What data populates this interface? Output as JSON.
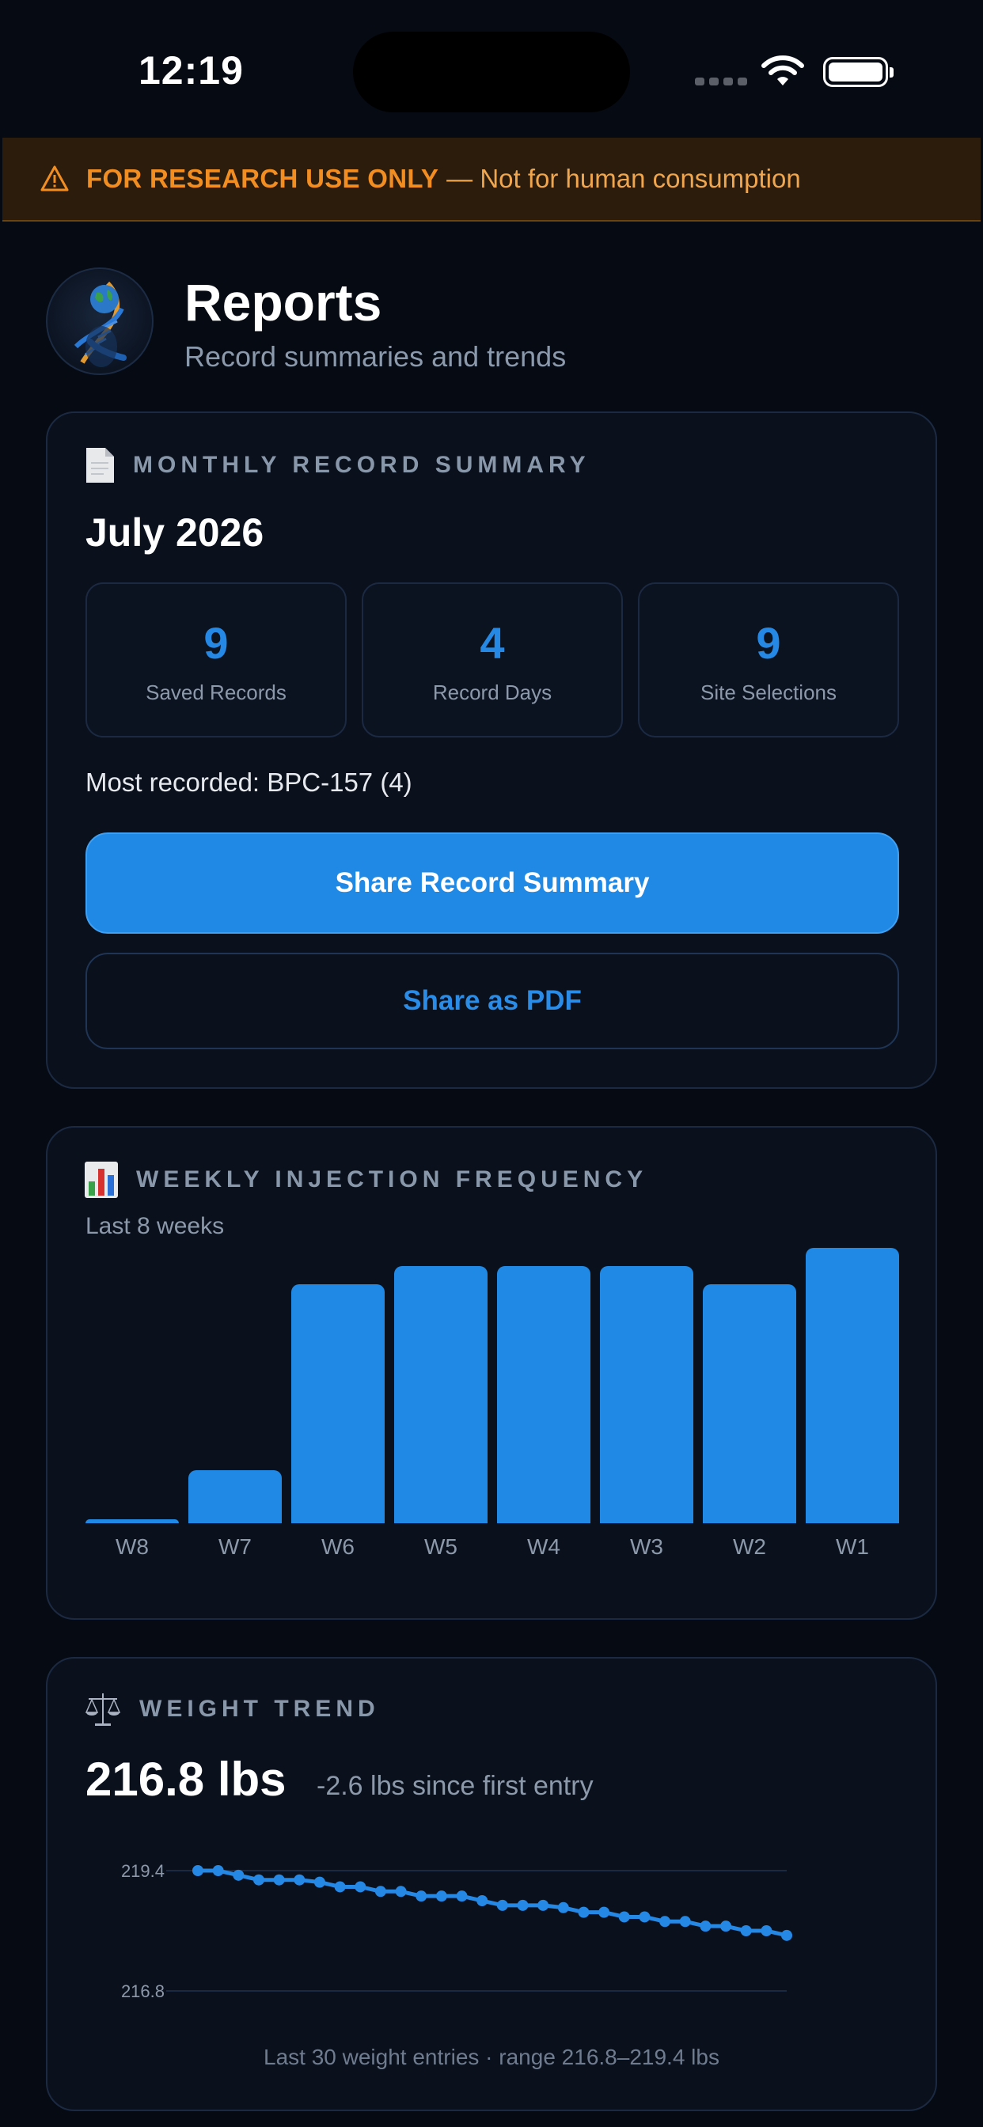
{
  "status": {
    "time": "12:19"
  },
  "warning": {
    "strong": "FOR RESEARCH USE ONLY",
    "rest": "— Not for human consumption"
  },
  "header": {
    "title": "Reports",
    "subtitle": "Record summaries and trends"
  },
  "summary": {
    "heading": "MONTHLY RECORD SUMMARY",
    "month": "July 2026",
    "stats": [
      {
        "value": "9",
        "label": "Saved Records"
      },
      {
        "value": "4",
        "label": "Record Days"
      },
      {
        "value": "9",
        "label": "Site Selections"
      }
    ],
    "most_recorded": "Most recorded: BPC-157 (4)",
    "share_button": "Share Record Summary",
    "pdf_button": "Share as PDF"
  },
  "frequency": {
    "heading": "WEEKLY INJECTION FREQUENCY",
    "subtitle": "Last 8 weeks"
  },
  "weight": {
    "heading": "WEIGHT TREND",
    "current": "216.8 lbs",
    "delta": "-2.6 lbs since first entry",
    "note": "Last 30 weight entries · range 216.8–219.4 lbs"
  },
  "chart_data": [
    {
      "type": "bar",
      "categories": [
        "W8",
        "W7",
        "W6",
        "W5",
        "W4",
        "W3",
        "W2",
        "W1"
      ],
      "values": [
        0.2,
        2.9,
        13,
        14,
        14,
        14,
        13,
        15
      ],
      "ylim": [
        0,
        15
      ],
      "color": "#1f89e5"
    },
    {
      "type": "line",
      "x": [
        1,
        2,
        3,
        4,
        5,
        6,
        7,
        8,
        9,
        10,
        11,
        12,
        13,
        14,
        15,
        16,
        17,
        18,
        19,
        20,
        21,
        22,
        23,
        24,
        25,
        26,
        27,
        28,
        29,
        30
      ],
      "values": [
        219.4,
        219.4,
        219.3,
        219.2,
        219.2,
        219.2,
        219.15,
        219.05,
        219.05,
        218.95,
        218.95,
        218.85,
        218.85,
        218.85,
        218.75,
        218.65,
        218.65,
        218.65,
        218.6,
        218.5,
        218.5,
        218.4,
        218.4,
        218.3,
        218.3,
        218.2,
        218.2,
        218.1,
        218.1,
        218.0
      ],
      "yticks": [
        "219.4",
        "216.8"
      ],
      "color": "#2688e5"
    }
  ]
}
